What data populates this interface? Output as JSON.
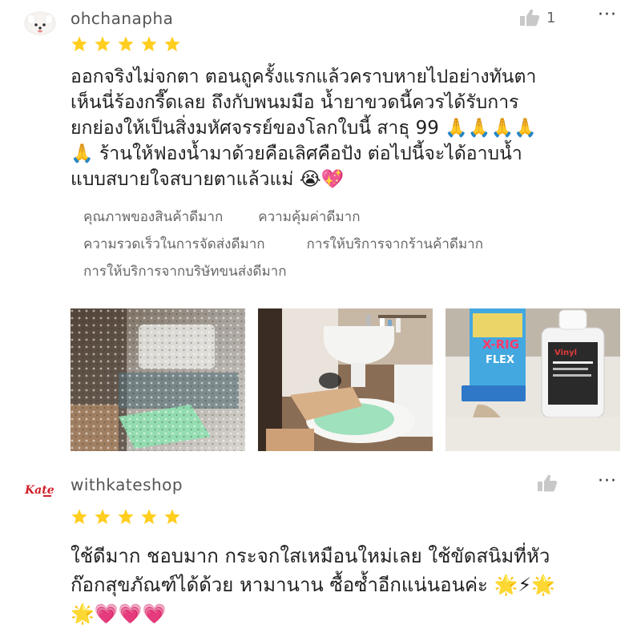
{
  "reviews": [
    {
      "username": "ohchanapha",
      "likes": "1",
      "rating": 5,
      "comment_lines": [
        "ออกจริงไม่จกตา ตอนถูครั้งแรกแล้วคราบหายไปอย่างทันตา",
        "เห็นนี่ร้องกรี๊ดเลย ถึงกับพนมมือ น้ำยาขวดนี้ควรได้รับการ",
        "ยกย่องให้เป็นสิ่งมหัศจรรย์ของโลกใบนี้ สาธุ 99 🙏🙏🙏🙏",
        "🙏 ร้านให้ฟองน้ำมาด้วยคือเลิศคือปัง ต่อไปนี้จะได้อาบน้ำ",
        "แบบสบายใจสบายตาแล้วแม่ 😭💖"
      ],
      "tags": [
        "คุณภาพของสินค้าดีมาก",
        "ความคุ้มค่าดีมาก",
        "ความรวดเร็วในการจัดส่งดีมาก",
        "การให้บริการจากร้านค้าดีมาก",
        "การให้บริการจากบริษัทขนส่งดีมาก"
      ],
      "photo_label": "Vinyl"
    },
    {
      "username": "withkateshop",
      "avatar_text": "Kate",
      "likes": "",
      "rating": 5,
      "comment_lines": [
        "ใช้ดีมาก ชอบมาก กระจกใสเหมือนใหม่เลย ใช้ขัดสนิมที่หัว",
        "ก๊อกสุขภัณฑ์ได้ด้วย หามานาน ซื้อซ้ำอีกแน่นอนค่ะ 🌟⚡🌟",
        "🌟💗💗💗"
      ]
    }
  ],
  "more_label": "···",
  "colors": {
    "star": "#ffce1f",
    "avatar_brand": "#d0202a"
  },
  "icons": {
    "like": "thumbs-up-icon",
    "more": "more-options-icon",
    "star": "star-icon"
  }
}
